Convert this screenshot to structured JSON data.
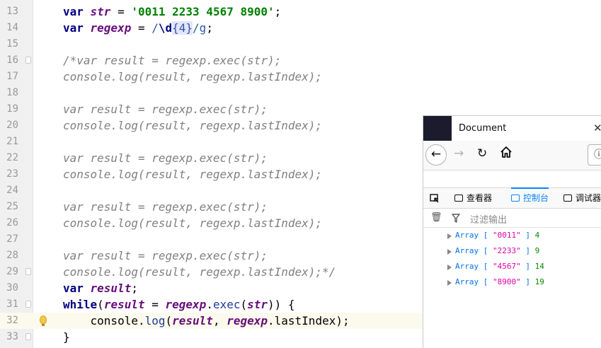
{
  "editor": {
    "lines": [
      {
        "num": "13",
        "fold": false,
        "current": false,
        "bulb": false,
        "parts": [
          [
            "kw",
            "var "
          ],
          [
            "var",
            "str"
          ],
          [
            "plain",
            " = "
          ],
          [
            "str",
            "'0011 2233 4567 8900'"
          ],
          [
            "plain",
            ";"
          ]
        ]
      },
      {
        "num": "14",
        "fold": false,
        "current": false,
        "bulb": false,
        "parts": [
          [
            "kw",
            "var "
          ],
          [
            "var",
            "regexp"
          ],
          [
            "plain",
            " = "
          ],
          [
            "re",
            "/"
          ],
          [
            "reesc",
            "\\d"
          ],
          [
            "hl",
            "{4}"
          ],
          [
            "re",
            "/g"
          ],
          [
            "plain",
            ";"
          ]
        ]
      },
      {
        "num": "15",
        "fold": false,
        "current": false,
        "bulb": false,
        "parts": []
      },
      {
        "num": "16",
        "fold": true,
        "current": false,
        "bulb": false,
        "parts": [
          [
            "cmt",
            "/*var result = regexp.exec(str);"
          ]
        ]
      },
      {
        "num": "17",
        "fold": false,
        "current": false,
        "bulb": false,
        "parts": [
          [
            "cmt",
            "console.log(result, regexp.lastIndex);"
          ]
        ]
      },
      {
        "num": "18",
        "fold": false,
        "current": false,
        "bulb": false,
        "parts": []
      },
      {
        "num": "19",
        "fold": false,
        "current": false,
        "bulb": false,
        "parts": [
          [
            "cmt",
            "var result = regexp.exec(str);"
          ]
        ]
      },
      {
        "num": "20",
        "fold": false,
        "current": false,
        "bulb": false,
        "parts": [
          [
            "cmt",
            "console.log(result, regexp.lastIndex);"
          ]
        ]
      },
      {
        "num": "21",
        "fold": false,
        "current": false,
        "bulb": false,
        "parts": []
      },
      {
        "num": "22",
        "fold": false,
        "current": false,
        "bulb": false,
        "parts": [
          [
            "cmt",
            "var result = regexp.exec(str);"
          ]
        ]
      },
      {
        "num": "23",
        "fold": false,
        "current": false,
        "bulb": false,
        "parts": [
          [
            "cmt",
            "console.log(result, regexp.lastIndex);"
          ]
        ]
      },
      {
        "num": "24",
        "fold": false,
        "current": false,
        "bulb": false,
        "parts": []
      },
      {
        "num": "25",
        "fold": false,
        "current": false,
        "bulb": false,
        "parts": [
          [
            "cmt",
            "var result = regexp.exec(str);"
          ]
        ]
      },
      {
        "num": "26",
        "fold": false,
        "current": false,
        "bulb": false,
        "parts": [
          [
            "cmt",
            "console.log(result, regexp.lastIndex);"
          ]
        ]
      },
      {
        "num": "27",
        "fold": false,
        "current": false,
        "bulb": false,
        "parts": []
      },
      {
        "num": "28",
        "fold": false,
        "current": false,
        "bulb": false,
        "parts": [
          [
            "cmt",
            "var result = regexp.exec(str);"
          ]
        ]
      },
      {
        "num": "29",
        "fold": true,
        "current": false,
        "bulb": false,
        "parts": [
          [
            "cmt",
            "console.log(result, regexp.lastIndex);*/"
          ]
        ]
      },
      {
        "num": "30",
        "fold": false,
        "current": false,
        "bulb": false,
        "parts": [
          [
            "kw",
            "var "
          ],
          [
            "var",
            "result"
          ],
          [
            "plain",
            ";"
          ]
        ]
      },
      {
        "num": "31",
        "fold": true,
        "current": false,
        "bulb": false,
        "parts": [
          [
            "kw",
            "while"
          ],
          [
            "plain",
            "("
          ],
          [
            "var",
            "result"
          ],
          [
            "plain",
            " = "
          ],
          [
            "var",
            "regexp"
          ],
          [
            "plain",
            "."
          ],
          [
            "fn",
            "exec"
          ],
          [
            "plain",
            "("
          ],
          [
            "var",
            "str"
          ],
          [
            "plain",
            ")) {"
          ]
        ]
      },
      {
        "num": "32",
        "fold": false,
        "current": true,
        "bulb": true,
        "parts": [
          [
            "plain",
            "    console."
          ],
          [
            "fn",
            "log"
          ],
          [
            "plain",
            "("
          ],
          [
            "var",
            "result"
          ],
          [
            "plain",
            ", "
          ],
          [
            "var",
            "regexp"
          ],
          [
            "plain",
            "."
          ],
          [
            "plain",
            "lastIndex);"
          ]
        ]
      },
      {
        "num": "33",
        "fold": true,
        "current": false,
        "bulb": false,
        "parts": [
          [
            "plain",
            "}"
          ]
        ]
      }
    ]
  },
  "browser": {
    "tab_title": "Document",
    "close_glyph": "✕",
    "nav": {
      "back_glyph": "←",
      "forward_glyph": "→",
      "reload_glyph": "↻",
      "url_glyph": "ⓘ"
    },
    "devtools_tabs": [
      {
        "label": "查看器",
        "icon": "inspector-icon",
        "active": false
      },
      {
        "label": "控制台",
        "icon": "console-icon",
        "active": true
      },
      {
        "label": "调试器",
        "icon": "debugger-icon",
        "active": false
      }
    ],
    "filter_placeholder": "过滤输出",
    "trash_glyph": "🗑",
    "filter_glyph": "⛛",
    "console_rows": [
      {
        "str": "\"0011\"",
        "num": "4"
      },
      {
        "str": "\"2233\"",
        "num": "9"
      },
      {
        "str": "\"4567\"",
        "num": "14"
      },
      {
        "str": "\"8900\"",
        "num": "19"
      }
    ],
    "array_label": "Array",
    "colors": {
      "accent": "#0a84ff",
      "string": "#dd00a9",
      "number": "#058b00",
      "tab_icon_bg": "#1c1b2e"
    }
  }
}
